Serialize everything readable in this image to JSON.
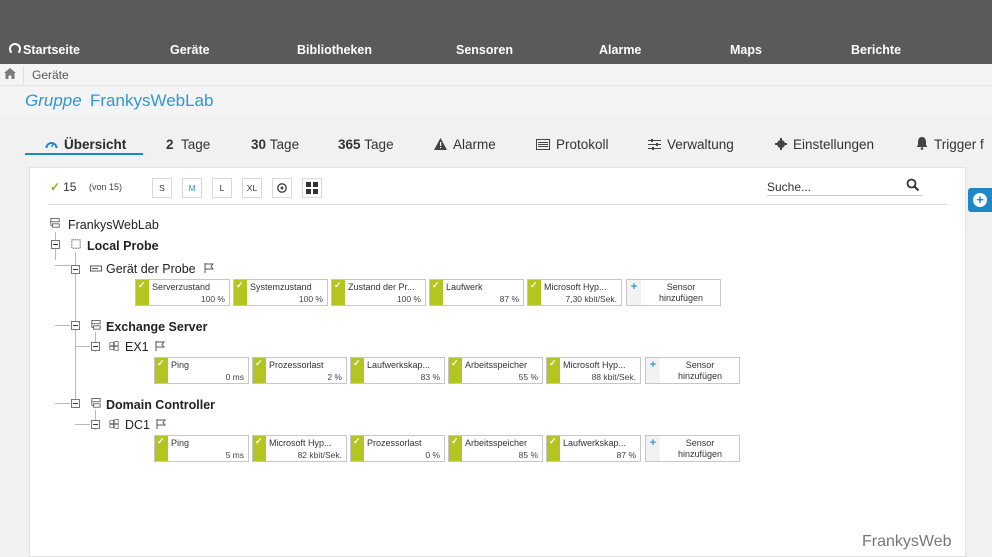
{
  "nav": {
    "home": "Startseite",
    "devices": "Geräte",
    "libraries": "Bibliotheken",
    "sensors": "Sensoren",
    "alarms": "Alarme",
    "maps": "Maps",
    "reports": "Berichte"
  },
  "breadcrumb": {
    "current": "Geräte"
  },
  "group": {
    "prefix": "Gruppe",
    "name": "FrankysWebLab"
  },
  "tabs": {
    "overview": "Übersicht",
    "days2_num": "2",
    "days2_label": "Tage",
    "days30_num": "30",
    "days30_label": "Tage",
    "days365_num": "365",
    "days365_label": "Tage",
    "alarms": "Alarme",
    "log": "Protokoll",
    "management": "Verwaltung",
    "settings": "Einstellungen",
    "triggers": "Trigger f"
  },
  "toolbar": {
    "ok_count": "15",
    "total": "(von 15)",
    "sizes": [
      "S",
      "M",
      "L",
      "XL"
    ],
    "active_size": "M",
    "search_placeholder": "Suche..."
  },
  "tree": {
    "root": "FrankysWebLab",
    "probe": "Local Probe",
    "probe_device": "Gerät der Probe",
    "exchange_group": "Exchange Server",
    "exchange_device": "EX1",
    "dc_group": "Domain Controller",
    "dc_device": "DC1"
  },
  "sensors": {
    "probe": [
      {
        "name": "Serverzustand",
        "value": "100 %"
      },
      {
        "name": "Systemzustand",
        "value": "100 %"
      },
      {
        "name": "Zustand der Pr...",
        "value": "100 %"
      },
      {
        "name": "Laufwerk",
        "value": "87 %"
      },
      {
        "name": "Microsoft Hyp...",
        "value": "7,30 kbit/Sek."
      }
    ],
    "ex1": [
      {
        "name": "Ping",
        "value": "0 ms"
      },
      {
        "name": "Prozessorlast",
        "value": "2 %"
      },
      {
        "name": "Laufwerkskap...",
        "value": "83 %"
      },
      {
        "name": "Arbeitsspeicher",
        "value": "55 %"
      },
      {
        "name": "Microsoft Hyp...",
        "value": "88 kbit/Sek."
      }
    ],
    "dc1": [
      {
        "name": "Ping",
        "value": "5 ms"
      },
      {
        "name": "Microsoft Hyp...",
        "value": "82 kbit/Sek."
      },
      {
        "name": "Prozessorlast",
        "value": "0 %"
      },
      {
        "name": "Arbeitsspeicher",
        "value": "85 %"
      },
      {
        "name": "Laufwerkskap...",
        "value": "87 %"
      }
    ],
    "add_label_1": "Sensor",
    "add_label_2": "hinzufügen"
  },
  "status_color": "#b4c421",
  "accent_color": "#2e97d4",
  "watermark": "FrankysWeb"
}
